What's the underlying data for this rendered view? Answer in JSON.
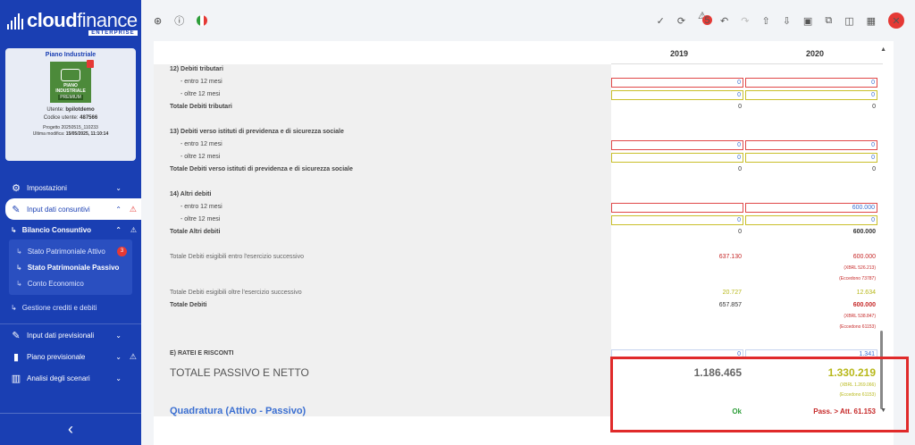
{
  "brand": {
    "name_bold": "cloud",
    "name_light": "finance",
    "edition": "ENTERPRISE"
  },
  "project_card": {
    "title": "Piano Industriale",
    "image_label": [
      "PIANO",
      "INDUSTRIALE"
    ],
    "image_badge": "PREMIUM",
    "user_label": "Utente:",
    "user_value": "bpilotdemo",
    "code_label": "Codice utente:",
    "code_value": "487566",
    "project_line": "Progetto 20250515_110233",
    "modified_label": "Ultima modifica:",
    "modified_value": "15/05/2025, 11:10:14"
  },
  "nav": {
    "settings": "Impostazioni",
    "input_actual": "Input dati consuntivi",
    "balance": "Bilancio Consuntivo",
    "leaf_assets": "Stato Patrimoniale Attivo",
    "leaf_assets_badge": "3",
    "leaf_liabilities": "Stato Patrimoniale Passivo",
    "leaf_income": "Conto Economico",
    "credits": "Gestione crediti e debiti",
    "input_forecast": "Input dati previsionali",
    "forecast_plan": "Piano previsionale",
    "scenarios": "Analisi degli scenari"
  },
  "topbar": {
    "notifications_count": "5"
  },
  "columns": {
    "y1": "2019",
    "y2": "2020"
  },
  "rows": [
    {
      "label": "12) Debiti tributari",
      "style": "b"
    },
    {
      "label": "- entro 12 mesi",
      "style": "ind",
      "v1": "0",
      "v2": "0",
      "t1": "in-red",
      "t2": "in-red"
    },
    {
      "label": "- oltre 12 mesi",
      "style": "ind",
      "v1": "0",
      "v2": "0",
      "t1": "in-yel",
      "t2": "in-yel"
    },
    {
      "label": "Totale Debiti tributari",
      "style": "b",
      "v1": "0",
      "v2": "0",
      "t1": "plain",
      "t2": "plain"
    },
    {
      "label": "13) Debiti verso istituti di previdenza e di sicurezza sociale",
      "style": "b"
    },
    {
      "label": "- entro 12 mesi",
      "style": "ind",
      "v1": "0",
      "v2": "0",
      "t1": "in-red",
      "t2": "in-red"
    },
    {
      "label": "- oltre 12 mesi",
      "style": "ind",
      "v1": "0",
      "v2": "0",
      "t1": "in-yel",
      "t2": "in-yel"
    },
    {
      "label": "Totale Debiti verso istituti di previdenza e di sicurezza sociale",
      "style": "b",
      "v1": "0",
      "v2": "0",
      "t1": "plain",
      "t2": "plain"
    },
    {
      "label": "14) Altri debiti",
      "style": "b"
    },
    {
      "label": "- entro 12 mesi",
      "style": "ind",
      "v1": "",
      "v2": "600.000",
      "t1": "in-red",
      "t2": "in-red"
    },
    {
      "label": "- oltre 12 mesi",
      "style": "ind",
      "v1": "0",
      "v2": "0",
      "t1": "in-yel",
      "t2": "in-yel"
    },
    {
      "label": "Totale Altri debiti",
      "style": "b",
      "v1": "0",
      "v2": "600.000",
      "t1": "plain",
      "t2": "plain pl-bold"
    },
    {
      "label": "Totale Debiti esigibili entro l'esercizio successivo",
      "style": "lt",
      "v1": "637.130",
      "v2": "600.000",
      "t1": "pl-red",
      "t2": "pl-red",
      "n2": [
        "(XBRL 526.213)",
        "(Eccedono 73787)"
      ]
    },
    {
      "label": "Totale Debiti esigibili oltre l'esercizio successivo",
      "style": "lt",
      "v1": "20.727",
      "v2": "12.634",
      "t1": "pl-yel",
      "t2": "pl-yel"
    },
    {
      "label": "Totale Debiti",
      "style": "b",
      "v1": "657.857",
      "v2": "600.000",
      "t1": "plain",
      "t2": "pl-red pl-bold",
      "n2": [
        "(XBRL 538.847)",
        "(Eccedono 61153)"
      ]
    },
    {
      "label": "E) RATEI E RISCONTI",
      "style": "b",
      "v1": "0",
      "v2": "1.341",
      "t1": "in-blue",
      "t2": "in-blue"
    }
  ],
  "total": {
    "label": "TOTALE PASSIVO E NETTO",
    "v1": "1.186.465",
    "v2": "1.330.219",
    "n2a": "(XBRL 1.269.066)",
    "n2b": "(Eccedono 61153)"
  },
  "quadratura": {
    "label": "Quadratura (Attivo - Passivo)",
    "v1": "Ok",
    "v2": "Pass. > Att. 61.153"
  },
  "colors": {
    "sidebar": "#1a3fb3",
    "alert_red": "#e53935",
    "link_blue": "#3b6fd1",
    "ok_green": "#2e9e3a"
  }
}
